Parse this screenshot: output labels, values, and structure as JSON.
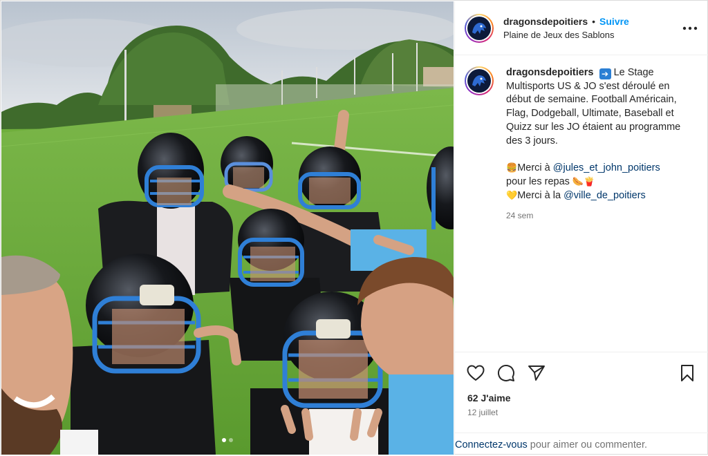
{
  "post": {
    "username": "dragonsdepoitiers",
    "follow_label": "Suivre",
    "separator": "•",
    "location": "Plaine de Jeux des Sablons",
    "more_icon": "more-horizontal-icon"
  },
  "caption": {
    "username": "dragonsdepoitiers",
    "arrow_emoji": "➡️",
    "text_1": "Le Stage Multisports US & JO s'est déroulé en début de semaine. Football Américain, Flag, Dodgeball, Ultimate, Baseball et Quizz sur les JO étaient au programme des 3 jours.",
    "burger_emoji": "🍔",
    "thanks_1_prefix": "Merci à",
    "mention_1": "@jules_et_john_poitiers",
    "thanks_1_suffix": "pour les repas",
    "hotdog_emoji": "🌭",
    "fries_emoji": "🍟",
    "heart_emoji": "💛",
    "thanks_2_prefix": "Merci à la",
    "mention_2": "@ville_de_poitiers",
    "time_ago": "24 sem"
  },
  "actions": {
    "like_icon": "heart-icon",
    "comment_icon": "comment-icon",
    "share_icon": "paper-plane-icon",
    "save_icon": "bookmark-icon",
    "likes": "62 J'aime",
    "date": "12 juillet"
  },
  "login": {
    "link_label": "Connectez-vous",
    "text": "pour aimer ou commenter."
  },
  "carousel": {
    "slides": 2,
    "active_index": 0
  },
  "colors": {
    "follow_blue": "#0095f6",
    "mention_blue": "#00376b",
    "muted_gray": "#737373",
    "border": "#dbdbdb"
  }
}
